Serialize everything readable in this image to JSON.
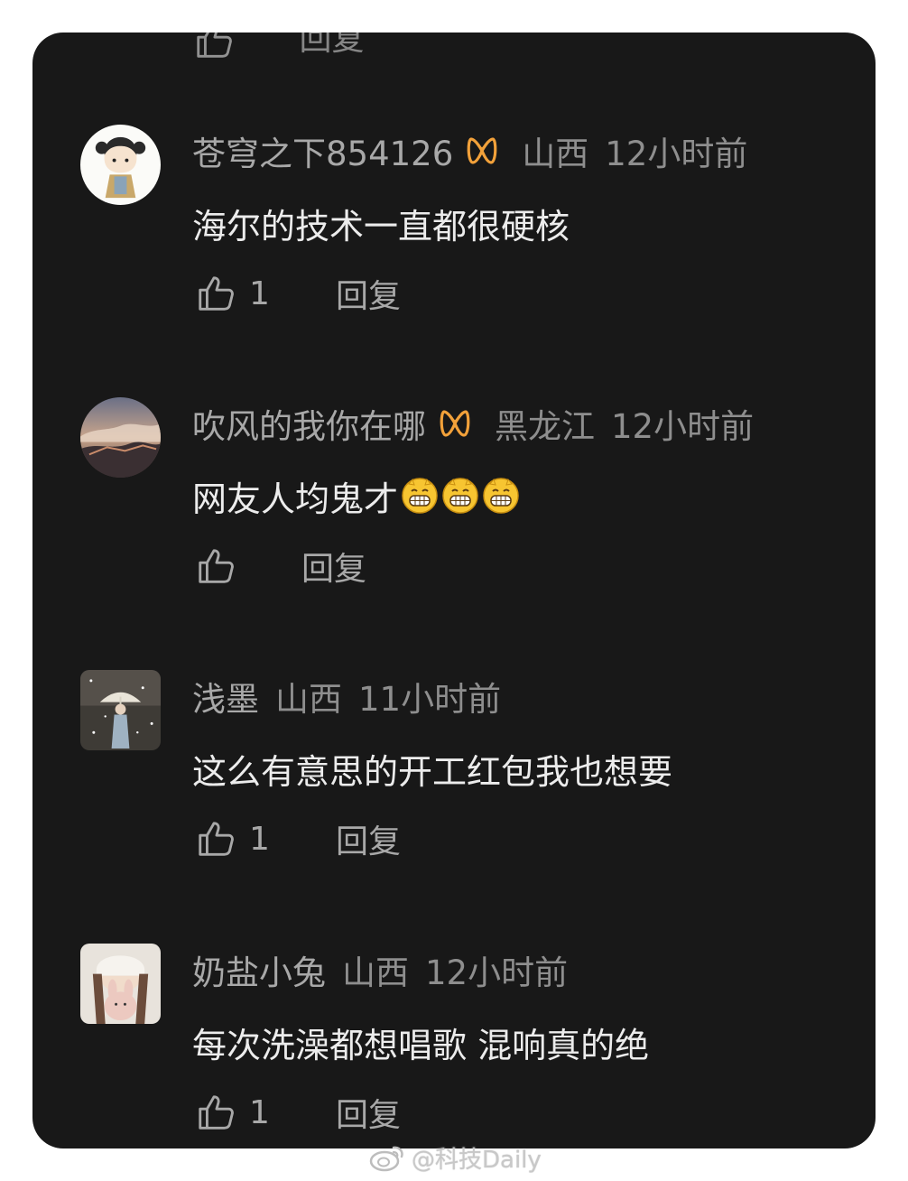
{
  "partial_top": {
    "reply_label": "回复"
  },
  "comments": [
    {
      "username": "苍穹之下854126",
      "has_badge": true,
      "location": "山西",
      "time": "12小时前",
      "text": "海尔的技术一直都很硬核",
      "emojis": 0,
      "likes": "1",
      "reply_label": "回复",
      "avatar": "cartoon-girl-avatar"
    },
    {
      "username": "吹风的我你在哪",
      "has_badge": true,
      "location": "黑龙江",
      "time": "12小时前",
      "text": "网友人均鬼才",
      "emojis": 3,
      "emoji_name": "grin-emoji",
      "likes": "",
      "reply_label": "回复",
      "avatar": "great-wall-landscape-avatar"
    },
    {
      "username": "浅墨",
      "has_badge": false,
      "location": "山西",
      "time": "11小时前",
      "text": "这么有意思的开工红包我也想要",
      "emojis": 0,
      "likes": "1",
      "reply_label": "回复",
      "avatar": "umbrella-snow-avatar"
    },
    {
      "username": "奶盐小兔",
      "has_badge": false,
      "location": "山西",
      "time": "12小时前",
      "text": "每次洗澡都想唱歌 混响真的绝",
      "emojis": 0,
      "likes": "1",
      "reply_label": "回复",
      "avatar": "girl-with-bunny-avatar"
    }
  ],
  "watermark": {
    "text": "@科技Daily",
    "icon": "weibo-logo-icon"
  },
  "colors": {
    "background": "#181818",
    "text_primary": "#ececec",
    "text_secondary": "#8e8e8e",
    "badge": "#f2a13a"
  }
}
